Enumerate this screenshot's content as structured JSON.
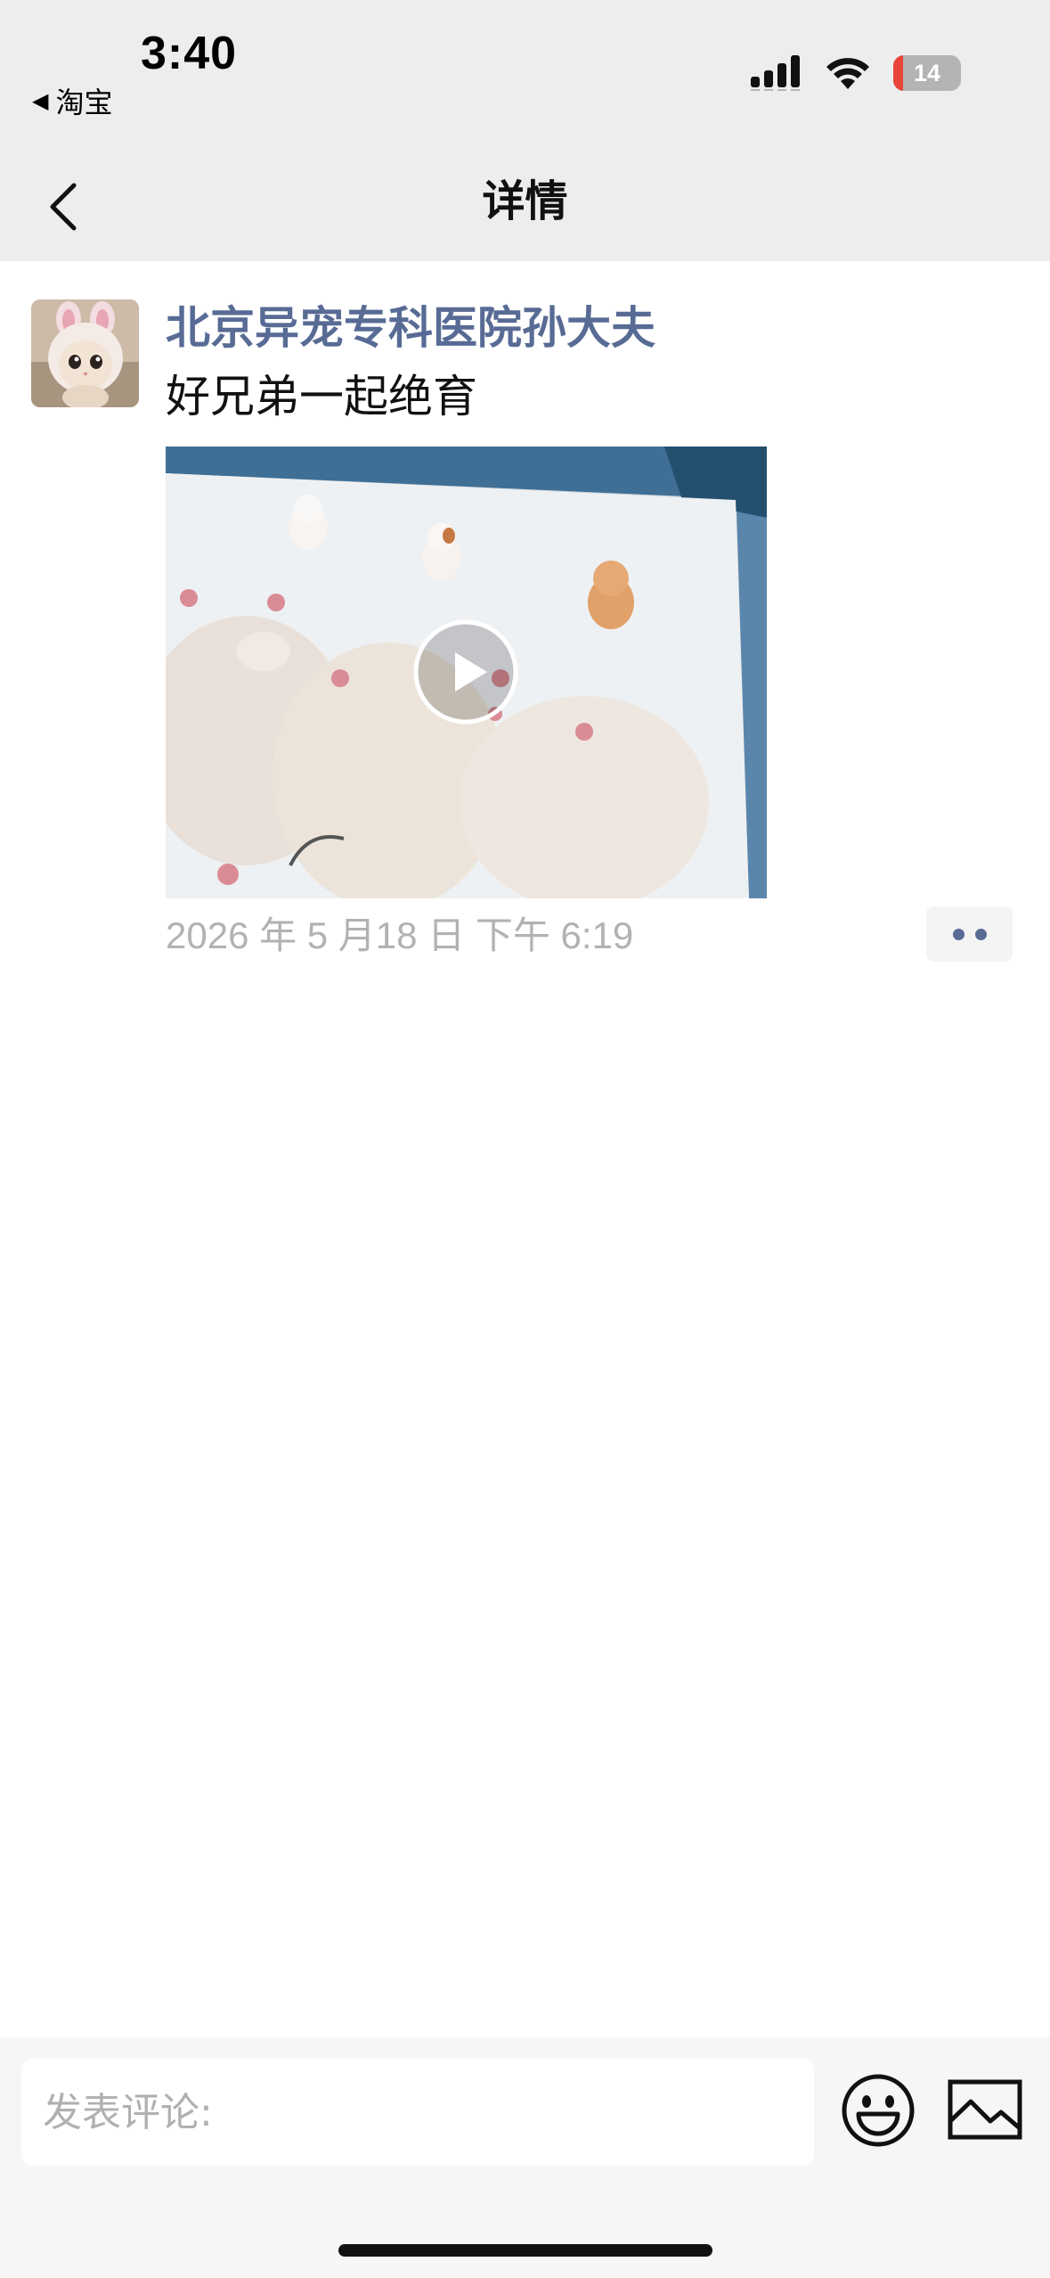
{
  "status_bar": {
    "time": "3:40",
    "back_app": "淘宝",
    "battery_level": "14",
    "icons": [
      "cellular-signal-icon",
      "wifi-icon",
      "battery-icon"
    ]
  },
  "nav": {
    "title": "详情",
    "back_icon": "chevron-left-icon"
  },
  "post": {
    "author": "北京异宠专科医院孙大夫",
    "text": "好兄弟一起绝育",
    "date": "2026 年 5 月18 日 下午 6:19",
    "media_type": "video",
    "more_icon": "two-dots-icon"
  },
  "comment_bar": {
    "placeholder": "发表评论:",
    "emoji_icon": "smiley-icon",
    "image_icon": "image-icon"
  },
  "colors": {
    "author_link": "#586b95",
    "nav_bg": "#ededed",
    "battery_low": "#e9443a"
  }
}
